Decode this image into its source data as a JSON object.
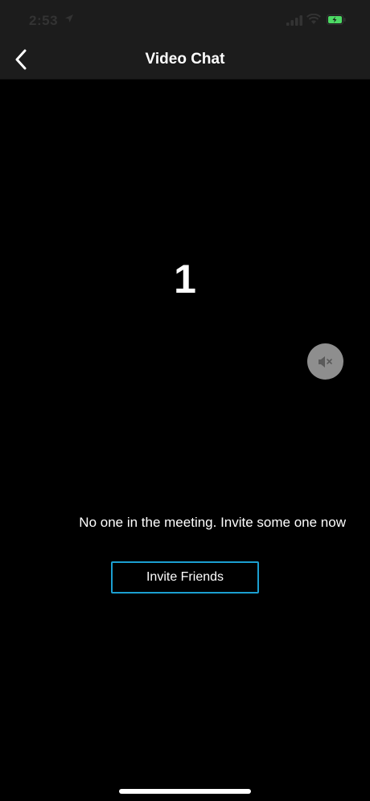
{
  "status_bar": {
    "time": "2:53",
    "icons": [
      "location-arrow-icon",
      "signal-bars-icon",
      "wifi-icon",
      "battery-charging-icon"
    ],
    "battery_color": "#4cd964"
  },
  "nav": {
    "back_icon": "chevron-left-icon",
    "title": "Video Chat"
  },
  "main": {
    "participant_count": "1",
    "mute_icon": "speaker-muted-icon",
    "empty_message": "No one in the meeting. Invite some one now",
    "invite_button_label": "Invite Friends"
  },
  "colors": {
    "background": "#000000",
    "bar": "#1c1c1c",
    "accent": "#1b9fd1",
    "mute_button_bg": "#8e8e8e"
  }
}
